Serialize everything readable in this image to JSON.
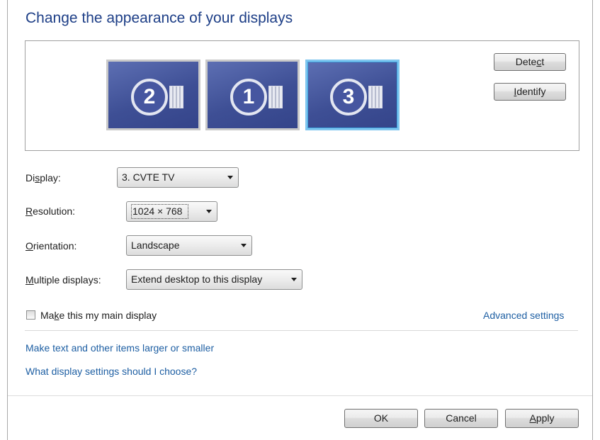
{
  "title": "Change the appearance of your displays",
  "monitors": [
    {
      "number": "2",
      "selected": false
    },
    {
      "number": "1",
      "selected": false
    },
    {
      "number": "3",
      "selected": true
    }
  ],
  "buttons": {
    "detect": {
      "pre": "Dete",
      "key": "c",
      "post": "t"
    },
    "identify": {
      "pre": "",
      "key": "I",
      "post": "dentify"
    }
  },
  "fields": {
    "display": {
      "label_pre": "Di",
      "label_key": "s",
      "label_post": "play:",
      "value": "3. CVTE TV"
    },
    "resolution": {
      "label_pre": "",
      "label_key": "R",
      "label_post": "esolution:",
      "value": "1024 × 768"
    },
    "orientation": {
      "label_pre": "",
      "label_key": "O",
      "label_post": "rientation:",
      "value": "Landscape"
    },
    "multiple_displays": {
      "label_pre": "",
      "label_key": "M",
      "label_post": "ultiple displays:",
      "value": "Extend desktop to this display"
    }
  },
  "main_display_checkbox": {
    "label_pre": "Ma",
    "label_key": "k",
    "label_post": "e this my main display",
    "checked": false
  },
  "links": {
    "advanced_settings": "Advanced settings",
    "text_size": "Make text and other items larger or smaller",
    "display_help": "What display settings should I choose?"
  },
  "footer": {
    "ok": "OK",
    "cancel": "Cancel",
    "apply": {
      "pre": "",
      "key": "A",
      "post": "pply"
    }
  },
  "colors": {
    "title": "#1e3f87",
    "link": "#1e5fa3",
    "monitor_face": "#3e4f95",
    "selected_border": "#7fc6ef"
  }
}
